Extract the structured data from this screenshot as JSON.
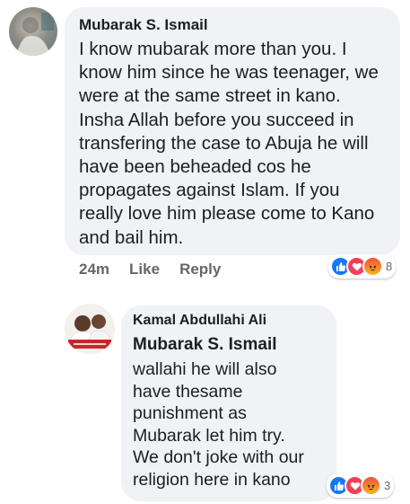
{
  "comment1": {
    "author": "Mubarak S. Ismail",
    "text": "I know mubarak more than you. I\nknow him since he was teenager, we\nwere at the same street in kano.\nInsha Allah before you succeed in\ntransfering the case to Abuja he will\nhave been beheaded cos he\npropagates against Islam. If you\nreally love him please come to Kano\nand bail him.",
    "time": "24m",
    "like_label": "Like",
    "reply_label": "Reply",
    "reaction_count": "8",
    "reactions": [
      "like-icon",
      "love-icon",
      "angry-icon"
    ]
  },
  "comment2": {
    "author": "Kamal Abdullahi Ali",
    "mention": "Mubarak S. Ismail",
    "text": "wallahi he will also\nhave thesame\npunishment as\nMubarak let him try.\nWe don't joke with our\nreligion here in kano",
    "reaction_count": "3",
    "reactions": [
      "like-icon",
      "love-icon",
      "angry-icon"
    ]
  },
  "colors": {
    "bubble": "#f0f2f5",
    "muted": "#65676b",
    "like": "#1877f2",
    "love": "#f33e58",
    "angry": "#f0523b"
  }
}
